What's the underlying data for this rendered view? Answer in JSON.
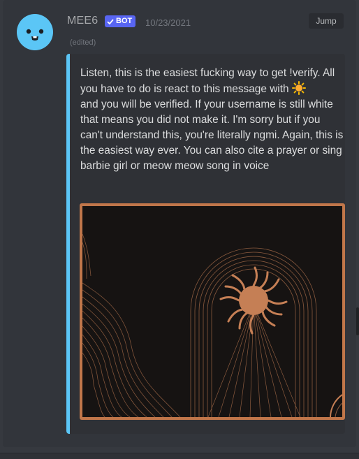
{
  "message": {
    "username": "MEE6",
    "bot_tag": "BOT",
    "timestamp": "10/23/2021",
    "jump_label": "Jump",
    "edited_label": "(edited)",
    "avatar_color": "#5bc6f6"
  },
  "embed": {
    "accent_color": "#5bc6f6",
    "text_before_emoji": "Listen, this is the easiest fucking way to get !verify. All you have to do is react to this message with ",
    "emoji": "sun-emoji",
    "text_after_emoji": "\nand you will be verified. If your username is still white that means you did not make it. I'm sorry but if you can't understand this, you're literally ngmi. Again, this is the easiest way ever. You can also cite a prayer or sing barbie girl or meow meow song in voice",
    "image": {
      "description_icon": "boho-sun-arch-art-icon",
      "frame_color": "#c0764a",
      "background_color": "#161312"
    }
  }
}
